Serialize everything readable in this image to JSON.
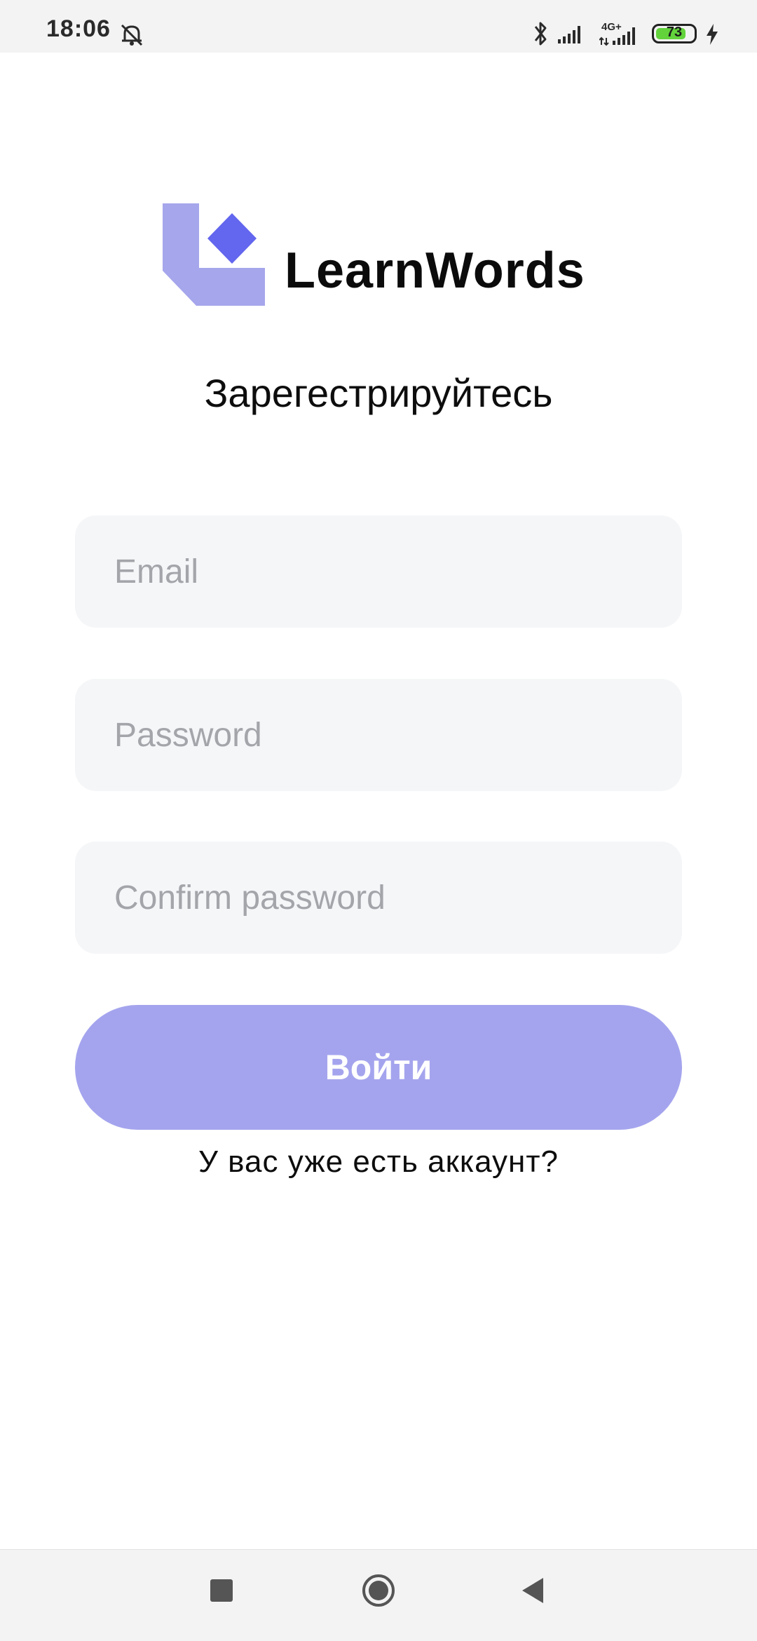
{
  "status_bar": {
    "time": "18:06",
    "network_type": "4G+",
    "battery_level": "73",
    "icons": [
      "alarm-off-icon",
      "bluetooth-icon",
      "signal-icon",
      "signal-4g-icon",
      "battery-icon",
      "charging-icon"
    ]
  },
  "app": {
    "brand_name": "LearnWords",
    "logo_colors": {
      "light": "#a6a6ec",
      "dark": "#6366ee"
    }
  },
  "screen": {
    "heading": "Зарегестрируйтесь"
  },
  "form": {
    "email_placeholder": "Email",
    "password_placeholder": "Password",
    "confirm_placeholder": "Confirm password",
    "submit_label": "Войти",
    "login_link": "У вас уже есть аккаунт?"
  },
  "colors": {
    "accent": "#a4a4ee",
    "field_bg": "#f5f6f8",
    "placeholder": "#a3a5aa"
  },
  "nav_bar": {
    "icons": [
      "recents-icon",
      "home-icon",
      "back-icon"
    ]
  }
}
